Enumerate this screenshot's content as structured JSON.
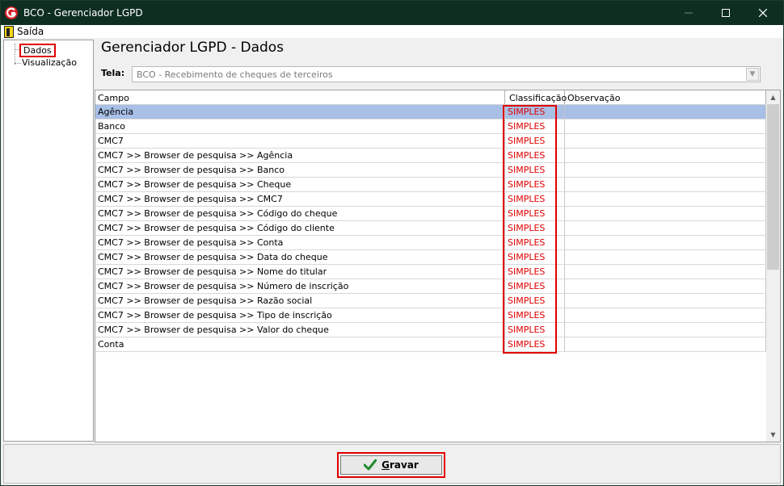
{
  "window": {
    "title": "BCO - Gerenciador LGPD"
  },
  "menu": {
    "exit_label": "Saída"
  },
  "tree": {
    "items": [
      {
        "label": "Dados"
      },
      {
        "label": "Visualização"
      }
    ]
  },
  "main": {
    "title": "Gerenciador LGPD - Dados",
    "tela_label": "Tela:",
    "tela_value": "BCO - Recebimento de cheques de terceiros"
  },
  "grid": {
    "columns": [
      "Campo",
      "Classificação",
      "Observação"
    ],
    "rows": [
      {
        "campo": "Agência",
        "classificacao": "SIMPLES",
        "observacao": ""
      },
      {
        "campo": "Banco",
        "classificacao": "SIMPLES",
        "observacao": ""
      },
      {
        "campo": "CMC7",
        "classificacao": "SIMPLES",
        "observacao": ""
      },
      {
        "campo": "CMC7 >> Browser de pesquisa >> Agência",
        "classificacao": "SIMPLES",
        "observacao": ""
      },
      {
        "campo": "CMC7 >> Browser de pesquisa >> Banco",
        "classificacao": "SIMPLES",
        "observacao": ""
      },
      {
        "campo": "CMC7 >> Browser de pesquisa >> Cheque",
        "classificacao": "SIMPLES",
        "observacao": ""
      },
      {
        "campo": "CMC7 >> Browser de pesquisa >> CMC7",
        "classificacao": "SIMPLES",
        "observacao": ""
      },
      {
        "campo": "CMC7 >> Browser de pesquisa >> Código do cheque",
        "classificacao": "SIMPLES",
        "observacao": ""
      },
      {
        "campo": "CMC7 >> Browser de pesquisa >> Código do cliente",
        "classificacao": "SIMPLES",
        "observacao": ""
      },
      {
        "campo": "CMC7 >> Browser de pesquisa >> Conta",
        "classificacao": "SIMPLES",
        "observacao": ""
      },
      {
        "campo": "CMC7 >> Browser de pesquisa >> Data do cheque",
        "classificacao": "SIMPLES",
        "observacao": ""
      },
      {
        "campo": "CMC7 >> Browser de pesquisa >> Nome do titular",
        "classificacao": "SIMPLES",
        "observacao": ""
      },
      {
        "campo": "CMC7 >> Browser de pesquisa >> Número de inscrição",
        "classificacao": "SIMPLES",
        "observacao": ""
      },
      {
        "campo": "CMC7 >> Browser de pesquisa >> Razão social",
        "classificacao": "SIMPLES",
        "observacao": ""
      },
      {
        "campo": "CMC7 >> Browser de pesquisa >> Tipo de inscrição",
        "classificacao": "SIMPLES",
        "observacao": ""
      },
      {
        "campo": "CMC7 >> Browser de pesquisa >> Valor do cheque",
        "classificacao": "SIMPLES",
        "observacao": ""
      },
      {
        "campo": "Conta",
        "classificacao": "SIMPLES",
        "observacao": ""
      }
    ]
  },
  "footer": {
    "save_label": "Gravar"
  },
  "colors": {
    "titlebar": "#0f2e22",
    "selected_row": "#a8bfe6",
    "classification_text": "#e00000",
    "highlight_border": "#e00000",
    "save_icon": "#1f8a2a"
  },
  "icons": {
    "app": "app-logo-icon",
    "exit": "exit-door-icon",
    "save": "checkmark-icon"
  }
}
